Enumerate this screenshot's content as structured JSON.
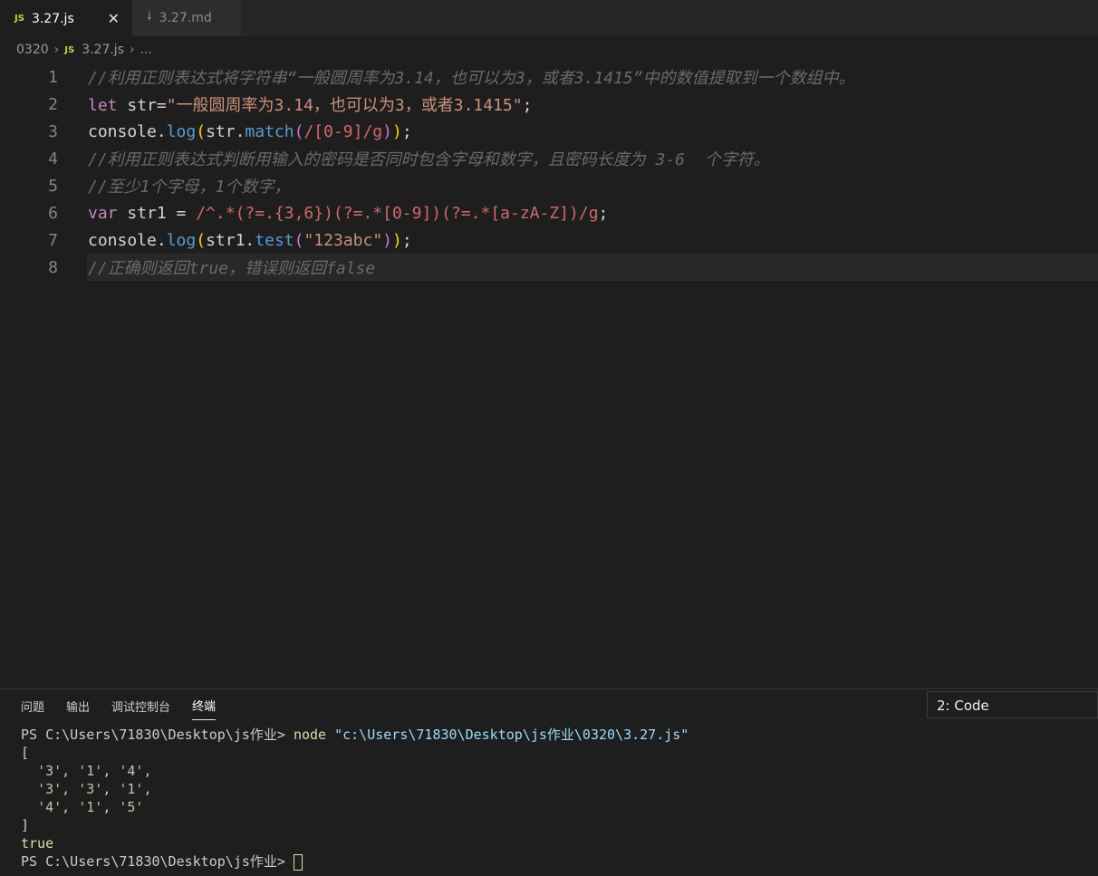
{
  "tabs": [
    {
      "icon": "JS",
      "label": "3.27.js",
      "active": true
    },
    {
      "icon": "md",
      "label": "3.27.md",
      "active": false
    }
  ],
  "breadcrumb": {
    "folder": "0320",
    "file_icon": "JS",
    "file": "3.27.js",
    "more": "..."
  },
  "editor": {
    "line_numbers": [
      "1",
      "2",
      "3",
      "4",
      "5",
      "6",
      "7",
      "8"
    ],
    "lines": {
      "l1": "//利用正则表达式将字符串“一般圆周率为3.14，也可以为3，或者3.1415”中的数值提取到一个数组中。",
      "l2_kw": "let",
      "l2_var": " str",
      "l2_eq": "=",
      "l2_str": "\"一般圆周率为3.14，也可以为3，或者3.1415\"",
      "l2_semi": ";",
      "l3_console": "console",
      "l3_dot": ".",
      "l3_log": "log",
      "l3_p1": "(",
      "l3_str": "str",
      "l3_dot2": ".",
      "l3_match": "match",
      "l3_p2": "(",
      "l3_regex": "/[0-9]/g",
      "l3_p2c": ")",
      "l3_p1c": ")",
      "l3_semi": ";",
      "l4": "//利用正则表达式判断用输入的密码是否同时包含字母和数字，且密码长度为 3-6  个字符。",
      "l5": "//至少1个字母，1个数字，",
      "l6_kw": "var",
      "l6_var": " str1",
      "l6_eq": " = ",
      "l6_regex": "/^.*(?=.{3,6})(?=.*[0-9])(?=.*[a-zA-Z])/g",
      "l6_semi": ";",
      "l7_console": "console",
      "l7_dot": ".",
      "l7_log": "log",
      "l7_p1": "(",
      "l7_str1": "str1",
      "l7_dot2": ".",
      "l7_test": "test",
      "l7_p2": "(",
      "l7_arg": "\"123abc\"",
      "l7_p2c": ")",
      "l7_p1c": ")",
      "l7_semi": ";",
      "l8": "//正确则返回true，错误则返回false"
    }
  },
  "panel": {
    "tabs": [
      "问题",
      "输出",
      "调试控制台",
      "终端"
    ],
    "active_tab": "终端",
    "terminal_select": "2: Code",
    "terminal": {
      "prompt1": "PS C:\\Users\\71830\\Desktop\\js作业> ",
      "cmd": "node",
      "arg": " \"c:\\Users\\71830\\Desktop\\js作业\\0320\\3.27.js\"",
      "open": "[",
      "row1": [
        "'3'",
        "'1'",
        "'4'"
      ],
      "row2": [
        "'3'",
        "'3'",
        "'1'"
      ],
      "row3": [
        "'4'",
        "'1'",
        "'5'"
      ],
      "close": "]",
      "result": "true",
      "prompt2": "PS C:\\Users\\71830\\Desktop\\js作业> "
    }
  },
  "colors": {
    "background": "#1e1e1e",
    "comment": "#6a6a6a",
    "keyword": "#c586c0",
    "string": "#ce9178",
    "regex": "#d16969"
  }
}
